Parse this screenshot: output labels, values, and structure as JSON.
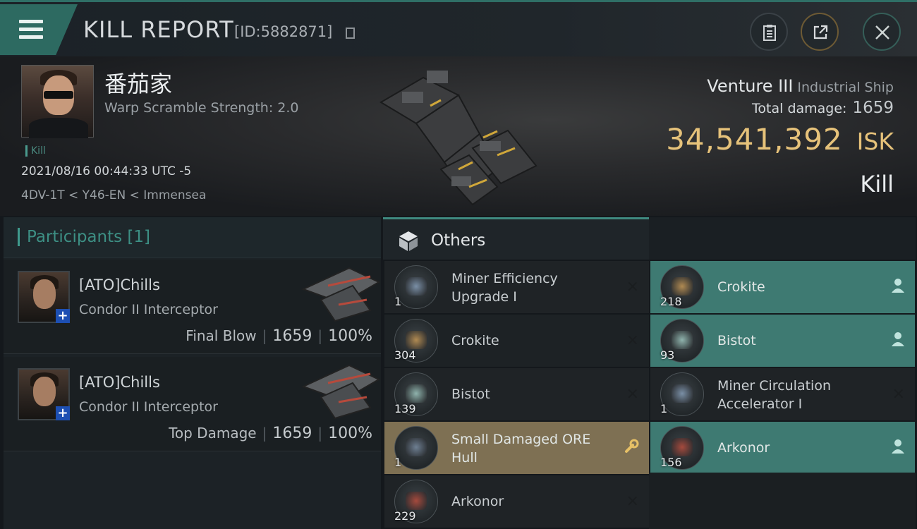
{
  "header": {
    "title": "KILL REPORT",
    "report_id": "[ID:5882871]",
    "buttons": {
      "clipboard": "clipboard-icon",
      "share": "share-icon",
      "close": "close-icon"
    }
  },
  "victim": {
    "pilot_name": "番茄家",
    "warp_scramble": "Warp Scramble Strength: 2.0",
    "tag": "Kill",
    "datetime": "2021/08/16 00:44:33 UTC -5",
    "location": "4DV-1T < Y46-EN < Immensea",
    "ship_name": "Venture III",
    "ship_class": "Industrial Ship",
    "total_damage_label": "Total damage:",
    "total_damage": "1659",
    "isk_value": "34,541,392",
    "isk_unit": "ISK",
    "status": "Kill"
  },
  "participants": {
    "title": "Participants [1]",
    "rows": [
      {
        "name": "[ATO]Chills",
        "ship": "Condor II Interceptor",
        "role": "Final Blow",
        "damage": "1659",
        "percent": "100%"
      },
      {
        "name": "[ATO]Chills",
        "ship": "Condor II Interceptor",
        "role": "Top Damage",
        "damage": "1659",
        "percent": "100%"
      }
    ]
  },
  "items": {
    "title": "Others",
    "left": [
      {
        "qty": "1",
        "name1": "Miner Efficiency",
        "name2": "Upgrade I",
        "action": "×",
        "state": "destroyed",
        "color": "#7a8fa6"
      },
      {
        "qty": "304",
        "name1": "Crokite",
        "name2": "",
        "action": "×",
        "state": "destroyed",
        "color": "#b08a52"
      },
      {
        "qty": "139",
        "name1": "Bistot",
        "name2": "",
        "action": "×",
        "state": "destroyed",
        "color": "#8fb3ad"
      },
      {
        "qty": "1",
        "name1": "Small Damaged ORE",
        "name2": "Hull",
        "action": "wrench-icon",
        "state": "salvage",
        "color": "#6e7f92"
      },
      {
        "qty": "229",
        "name1": "Arkonor",
        "name2": "",
        "action": "×",
        "state": "destroyed",
        "color": "#a54a3d"
      }
    ],
    "right": [
      {
        "qty": "218",
        "name1": "Crokite",
        "name2": "",
        "action": "person-icon",
        "state": "dropped",
        "color": "#b08a52"
      },
      {
        "qty": "93",
        "name1": "Bistot",
        "name2": "",
        "action": "person-icon",
        "state": "dropped",
        "color": "#8fb3ad"
      },
      {
        "qty": "1",
        "name1": "Miner Circulation",
        "name2": "Accelerator I",
        "action": "×",
        "state": "destroyed",
        "color": "#7a8fa6"
      },
      {
        "qty": "156",
        "name1": "Arkonor",
        "name2": "",
        "action": "person-icon",
        "state": "dropped",
        "color": "#a54a3d"
      }
    ]
  },
  "colors": {
    "accent_teal": "#3f8a80",
    "isk_gold": "#e6c27a",
    "dropped_bg": "#3e7a72",
    "fitted_bg": "#7e7053"
  }
}
